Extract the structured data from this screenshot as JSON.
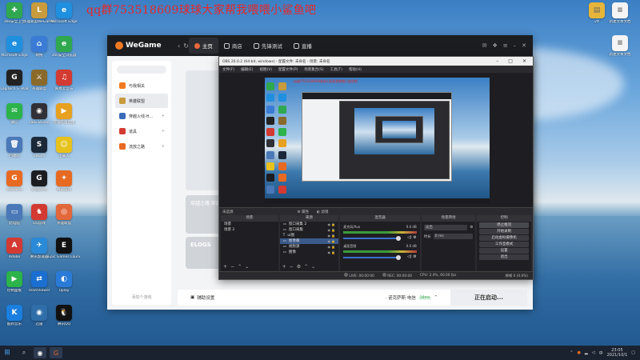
{
  "overlay_text": "qq群753518609球球大家帮我喂喂小鲨鱼吧",
  "desktop_icons_left": [
    {
      "label": "360安全卫士",
      "color": "#2fa84f",
      "sym": "✚"
    },
    {
      "label": "英雄联盟WeGame版",
      "color": "#c89b3c",
      "sym": "L"
    },
    {
      "label": "Microsoft Edge",
      "color": "#1f8fe0",
      "sym": "e"
    },
    {
      "label": "Microsoft Edge",
      "color": "#1f8fe0",
      "sym": "e"
    },
    {
      "label": "网络",
      "color": "#3a7bd5",
      "sym": "⌂"
    },
    {
      "label": "360安全浏览器",
      "color": "#2fa84f",
      "sym": "e"
    },
    {
      "label": "Logitech G HUB",
      "color": "#222",
      "sym": "G"
    },
    {
      "label": "英雄联盟",
      "color": "#8a6a2a",
      "sym": "⚔"
    },
    {
      "label": "网易云音乐",
      "color": "#d33a31",
      "sym": "♫"
    },
    {
      "label": "微信",
      "color": "#2cb34a",
      "sym": "✉"
    },
    {
      "label": "OBS Studio",
      "color": "#303036",
      "sym": "◉"
    },
    {
      "label": "哔哩哔哩直播",
      "color": "#e8a020",
      "sym": "▶"
    },
    {
      "label": "回收站",
      "color": "#4a78b8",
      "sym": "🗑"
    },
    {
      "label": "Steam",
      "color": "#1b2838",
      "sym": "S"
    },
    {
      "label": "小黄人",
      "color": "#e7c21d",
      "sym": "☺"
    },
    {
      "label": "WeGame",
      "color": "#e86a22",
      "sym": "G"
    },
    {
      "label": "Wegame",
      "color": "#1c1d21",
      "sym": "G"
    },
    {
      "label": "腾讯游戏",
      "color": "#e86a22",
      "sym": "✦"
    },
    {
      "label": "此电脑",
      "color": "#4a78b8",
      "sym": "▭"
    },
    {
      "label": "QQ游戏",
      "color": "#d33a31",
      "sym": "♞"
    },
    {
      "label": "英雄联盟",
      "color": "#e2673b",
      "sym": "◎"
    },
    {
      "label": "Adobe",
      "color": "#d33a31",
      "sym": "A"
    },
    {
      "label": "腾讯加速器",
      "color": "#2a8ad8",
      "sym": "✈"
    },
    {
      "label": "Epic Games Launcher",
      "color": "#111",
      "sym": "E"
    },
    {
      "label": "控制面板",
      "color": "#2cb34a",
      "sym": "▶"
    },
    {
      "label": "TeamViewer",
      "color": "#1a6fd1",
      "sym": "⇄"
    },
    {
      "label": "Uplay",
      "color": "#2a7bd8",
      "sym": "◐"
    },
    {
      "label": "酷狗音乐",
      "color": "#1a7fe0",
      "sym": "K"
    },
    {
      "label": "迅雷",
      "color": "#2f6ea8",
      "sym": "◉"
    },
    {
      "label": "腾讯QQ",
      "color": "#111",
      "sym": "🐧"
    }
  ],
  "desktop_icons_right": [
    {
      "label": "vtf",
      "color": "#e6b53a",
      "sym": "▤"
    },
    {
      "label": "新建文本文档",
      "color": "#f4f4f4",
      "sym": "≡"
    },
    {
      "label": "新建文本文档",
      "color": "#f4f4f4",
      "sym": "≡"
    }
  ],
  "wegame": {
    "brand": "WeGame",
    "tabs": [
      {
        "label": "主页",
        "active": true
      },
      {
        "label": "商店"
      },
      {
        "label": "先锋测试"
      },
      {
        "label": "直播"
      }
    ],
    "sidebar": [
      {
        "label": "与我相关",
        "color": "#f07a22"
      },
      {
        "label": "英雄联盟",
        "color": "#c89b3c",
        "active": true
      },
      {
        "label": "穿越火线-H...",
        "color": "#3a6ab8",
        "plus": true
      },
      {
        "label": "道具",
        "color": "#d33a31",
        "plus": true
      },
      {
        "label": "流放之路",
        "color": "#e86a22",
        "plus": true
      }
    ],
    "sidebar_footer": "添加个游戏",
    "cards": [
      "穿越之路 穿越之路",
      "ELOGS"
    ],
    "aux_settings": "辅助设置",
    "server": "· 诺克萨斯 电信",
    "server_ping": "18ms",
    "start_button": "正在启动..."
  },
  "obs": {
    "title": "OBS 26.0.2 (64-bit, windows) - 配置文件: 未命名 - 场景: 未命名",
    "menu": [
      "文件(F)",
      "编辑(E)",
      "视图(V)",
      "配置文件(P)",
      "场景集合(S)",
      "工具(T)",
      "帮助(H)"
    ],
    "preview_caption": "qq群753518609球球大家帮我喂喂小鲨鱼吧",
    "scenebar": "未选源",
    "scenebar_props": "属性",
    "scenebar_filters": "滤镜",
    "docks": {
      "scenes": "场景",
      "sources": "来源",
      "mixer": "混音器",
      "transitions": "场景转场",
      "controls": "控制"
    },
    "scenes": [
      "场景",
      "场景 2"
    ],
    "sources": [
      "窗口采集 2",
      "窗口采集",
      "ui图",
      "图像幕",
      "视频源",
      "图像"
    ],
    "mixer": [
      {
        "name": "麦克风/Aux",
        "db": "0.0 dB"
      },
      {
        "name": "桌面音频",
        "db": "0.0 dB"
      }
    ],
    "transition": "淡出",
    "duration_label": "时长",
    "duration": "0 ms",
    "controls": [
      "停止推流",
      "开始录制",
      "启动虚拟摄像机",
      "工作室模式",
      "设置",
      "退出"
    ],
    "status": {
      "live": "LIVE: 00:00:00",
      "rec": "REC: 00:00:00",
      "cpu": "CPU: 2.4%, 60.00 fps",
      "dropped": "掉帧 0 (0.0%)"
    }
  },
  "taskbar": {
    "time": "23:05",
    "date": "2021/10/1",
    "lang": "中"
  }
}
